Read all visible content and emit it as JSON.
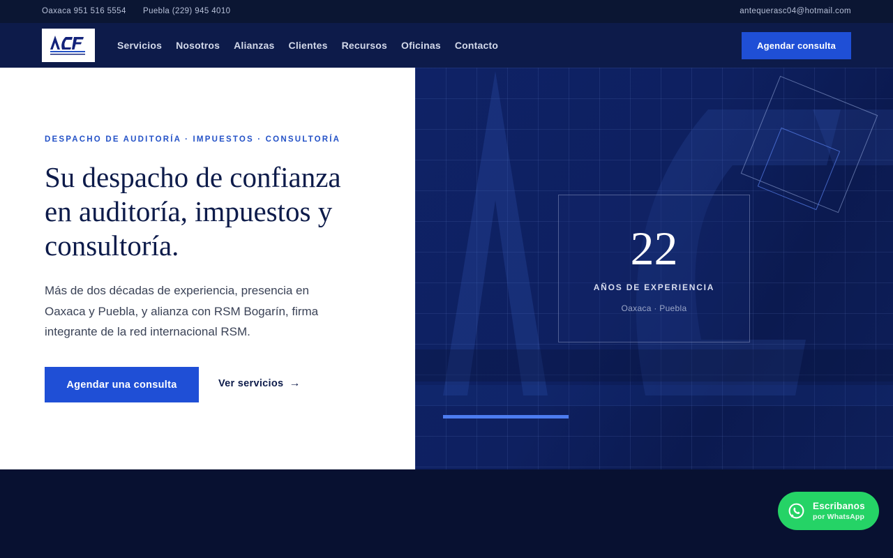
{
  "topbar": {
    "phone_oaxaca": "Oaxaca 951 516 5554",
    "phone_puebla": "Puebla (229) 945 4010",
    "email": "antequerasc04@hotmail.com"
  },
  "nav": {
    "logo_text": "ACF",
    "links": [
      "Servicios",
      "Nosotros",
      "Alianzas",
      "Clientes",
      "Recursos",
      "Oficinas",
      "Contacto"
    ],
    "cta": "Agendar consulta"
  },
  "hero": {
    "eyebrow": "DESPACHO DE AUDITORÍA · IMPUESTOS · CONSULTORÍA",
    "headline": "Su despacho de confianza en auditoría, impuestos y consultoría.",
    "lead": "Más de dos décadas de experiencia, presencia en Oaxaca y Puebla, y alianza con RSM Bogarín, firma integrante de la red internacional RSM.",
    "primary_cta": "Agendar una consulta",
    "secondary_cta": "Ver servicios",
    "arrow": "→"
  },
  "stat": {
    "number": "22",
    "label": "AÑOS DE EXPERIENCIA",
    "sub": "Oaxaca · Puebla"
  },
  "whatsapp": {
    "title": "Escribanos",
    "sub": "por WhatsApp",
    "icon": "whatsapp-icon"
  },
  "colors": {
    "primary": "#1f4fd6",
    "navy": "#0d1b4a",
    "accent": "#4d7cf0",
    "whatsapp": "#25d366"
  }
}
